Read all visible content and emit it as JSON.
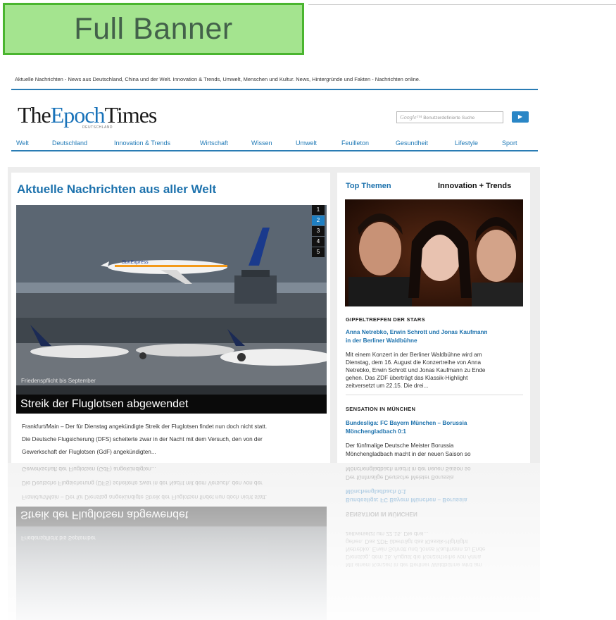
{
  "banner": {
    "label": "Full Banner"
  },
  "site": {
    "tagline": "Aktuelle Nachrichten - News aus Deutschland, China und der Welt. Innovation & Trends, Umwelt, Menschen und Kultur. News, Hintergründe und Fakten - Nachrichten online.",
    "logo_the": "The",
    "logo_epoch": "Epoch",
    "logo_times": "Times",
    "logo_sub": "DEUTSCHLAND",
    "search_brand": "Google™",
    "search_placeholder": "Benutzerdefinierte Suche",
    "search_button": "▶"
  },
  "nav": [
    "Welt",
    "Deutschland",
    "Innovation & Trends",
    "Wirtschaft",
    "Wissen",
    "Umwelt",
    "Feuilleton",
    "Gesundheit",
    "Lifestyle",
    "Sport"
  ],
  "lead": {
    "section_title": "Aktuelle Nachrichten aus aller Welt",
    "pager": [
      "1",
      "2",
      "3",
      "4",
      "5"
    ],
    "active_page": "2",
    "image_caption": "Friedenspflicht bis September",
    "headline": "Streik der Fluglotsen abgewendet",
    "plane_livery": "SunExpress",
    "body": [
      "Frankfurt/Main – Der für Dienstag angekündigte Streik der Fluglotsen findet nun doch nicht statt.",
      "Die Deutsche Flugsicherung (DFS) scheiterte zwar in der Nacht mit dem Versuch, den von der",
      "Gewerkschaft der Fluglotsen (GdF) angekündigten..."
    ]
  },
  "sidebar": {
    "tab_top": "Top Themen",
    "tab_innovation": "Innovation + Trends",
    "stories": [
      {
        "kicker": "GIPFELTREFFEN DER STARS",
        "headline": [
          "Anna Netrebko, Erwin Schrott und Jonas Kaufmann",
          "in der Berliner Waldbühne"
        ],
        "summary": [
          "Mit einem Konzert in der Berliner Waldbühne wird am",
          "Dienstag, dem 16. August die Konzertreihe von Anna",
          "Netrebko, Erwin Schrott und Jonas Kaufmann zu Ende",
          "gehen. Das ZDF überträgt das Klassik-Highlight",
          "zeitversetzt um 22.15. Die drei..."
        ]
      },
      {
        "kicker": "SENSATION IN MÜNCHEN",
        "headline": [
          "Bundesliga: FC Bayern München – Borussia",
          "Mönchengladbach 0:1"
        ],
        "summary": [
          "Der fünfmalige Deutsche Meister Borussia",
          "Mönchengladbach macht in der neuen Saison so"
        ]
      }
    ]
  },
  "colors": {
    "accent": "#1d72ad",
    "banner_fill": "#a4e48f",
    "banner_border": "#4ab52f"
  }
}
